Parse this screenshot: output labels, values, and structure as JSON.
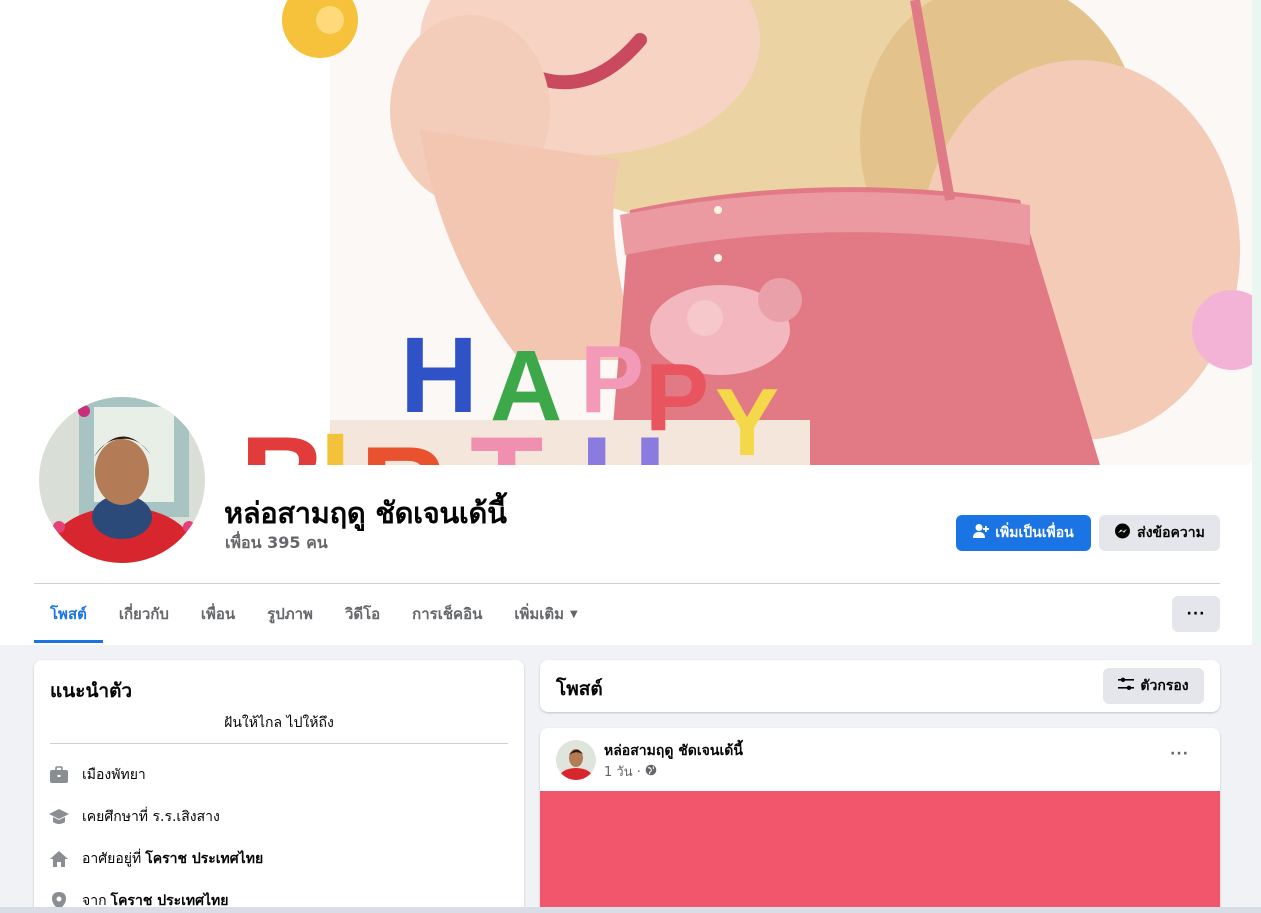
{
  "profile": {
    "name": "หล่อสามฤดู ชัดเจนเด้นี้",
    "friends_text": "เพื่อน 395 คน"
  },
  "cover": {
    "banner_text_1": "HAPPY",
    "banner_text_2": "BIRTHD"
  },
  "actions": {
    "add_friend": "เพิ่มเป็นเพื่อน",
    "message": "ส่งข้อความ"
  },
  "tabs": [
    {
      "label": "โพสต์"
    },
    {
      "label": "เกี่ยวกับ"
    },
    {
      "label": "เพื่อน"
    },
    {
      "label": "รูปภาพ"
    },
    {
      "label": "วิดีโอ"
    },
    {
      "label": "การเช็คอิน"
    },
    {
      "label": "เพิ่มเติม"
    }
  ],
  "more_menu": "···",
  "intro": {
    "title": "แนะนำตัว",
    "bio": "ฝันให้ไกล ไปให้ถึง",
    "work": "เมืองพัทยา",
    "education": "เคยศึกษาที่ ร.ร.เสิงสาง",
    "lives_prefix": "อาศัยอยู่ที่",
    "lives_place": "โคราช ประเทศไทย",
    "from_prefix": "จาก",
    "from_place": "โคราช ประเทศไทย"
  },
  "posts": {
    "title": "โพสต์",
    "filter": "ตัวกรอง"
  },
  "post": {
    "author": "หล่อสามฤดู ชัดเจนเด้นี้",
    "time": "1 วัน ·",
    "menu": "···",
    "image_color": "#f2566c"
  },
  "colors": {
    "primary": "#1b74e4",
    "secondary_button": "#e4e6eb",
    "page_bg": "#f0f2f5"
  }
}
